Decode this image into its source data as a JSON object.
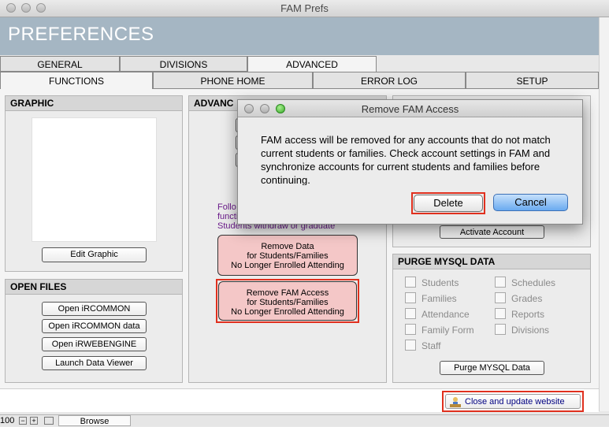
{
  "window": {
    "title": "FAM Prefs"
  },
  "banner": {
    "title": "PREFERENCES"
  },
  "tabs_top": [
    {
      "label": "GENERAL"
    },
    {
      "label": "DIVISIONS"
    },
    {
      "label": "ADVANCED"
    }
  ],
  "tabs_sub": [
    {
      "label": "FUNCTIONS"
    },
    {
      "label": "PHONE HOME"
    },
    {
      "label": "ERROR LOG"
    },
    {
      "label": "SETUP"
    }
  ],
  "graphic": {
    "title": "GRAPHIC",
    "edit_label": "Edit Graphic"
  },
  "open_files": {
    "title": "OPEN FILES",
    "buttons": [
      "Open iRCOMMON",
      "Open iRCOMMON data",
      "Open iRWEBENGINE",
      "Launch Data Viewer"
    ]
  },
  "advanced": {
    "title": "ADVANC",
    "note_lines": [
      "Follo",
      "functi",
      "Students withdraw or graduate"
    ],
    "remove_data_lines": [
      "Remove Data",
      "for Students/Families",
      "No Longer Enrolled Attending"
    ],
    "remove_fam_lines": [
      "Remove FAM Access",
      "for Students/Families",
      "No Longer Enrolled Attending"
    ]
  },
  "activate": {
    "label": "Activate Account"
  },
  "purge": {
    "title": "PURGE MYSQL DATA",
    "col1": [
      "Students",
      "Families",
      "Attendance",
      "Family Form",
      "Staff"
    ],
    "col2": [
      "Schedules",
      "Grades",
      "Reports",
      "Divisions"
    ],
    "button": "Purge MYSQL Data"
  },
  "footer": {
    "close_label": "Close and update website"
  },
  "status": {
    "zoom": "100",
    "mode": "Browse"
  },
  "dialog": {
    "title": "Remove FAM Access",
    "message": "FAM access will be removed for any accounts that do not match current students or families. Check account settings in FAM and synchronize accounts for current students and families before continuing.",
    "delete_label": "Delete",
    "cancel_label": "Cancel"
  },
  "colors": {
    "banner": "#a5b6c3",
    "highlight": "#e0301e",
    "pink": "#f4c7c7",
    "note": "#6a1a8a",
    "default_button": "#6aaaf0"
  }
}
